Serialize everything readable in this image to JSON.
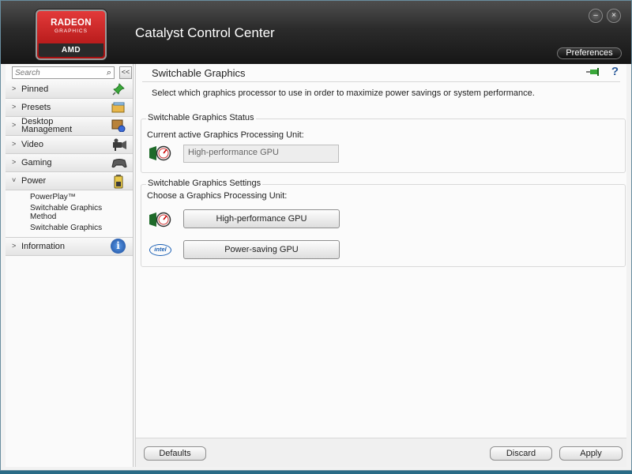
{
  "app": {
    "title": "Catalyst Control Center",
    "logo": {
      "line1": "RADEON",
      "line2": "GRAPHICS",
      "brand": "AMD"
    },
    "preferences_label": "Preferences",
    "window_controls": {
      "minimize": "–",
      "close": "×"
    }
  },
  "sidebar": {
    "search": {
      "placeholder": "Search",
      "value": ""
    },
    "collapse_label": "<<",
    "items": [
      {
        "label": "Pinned",
        "chevron": ">",
        "icon": "pin-icon"
      },
      {
        "label": "Presets",
        "chevron": ">",
        "icon": "presets-icon"
      },
      {
        "label": "Desktop\nManagement",
        "chevron": ">",
        "icon": "desktop-icon"
      },
      {
        "label": "Video",
        "chevron": ">",
        "icon": "video-camera-icon"
      },
      {
        "label": "Gaming",
        "chevron": ">",
        "icon": "gamepad-icon"
      },
      {
        "label": "Power",
        "chevron": "˅",
        "icon": "battery-icon"
      }
    ],
    "power_subitems": [
      "PowerPlay™",
      "Switchable Graphics Method",
      "Switchable Graphics"
    ],
    "information": {
      "label": "Information",
      "chevron": ">",
      "icon_text": "i"
    }
  },
  "main": {
    "title": "Switchable Graphics",
    "help_label": "?",
    "description": "Select which graphics processor to use in order to maximize power savings or system performance.",
    "status_group": {
      "title": "Switchable Graphics Status",
      "current_label": "Current active Graphics Processing Unit:",
      "current_value": "High-performance GPU"
    },
    "settings_group": {
      "title": "Switchable Graphics Settings",
      "choose_label": "Choose a Graphics Processing Unit:",
      "high_perf_button": "High-performance GPU",
      "power_saving_button": "Power-saving GPU",
      "intel_logo": "intel"
    },
    "footer": {
      "defaults": "Defaults",
      "discard": "Discard",
      "apply": "Apply"
    }
  }
}
